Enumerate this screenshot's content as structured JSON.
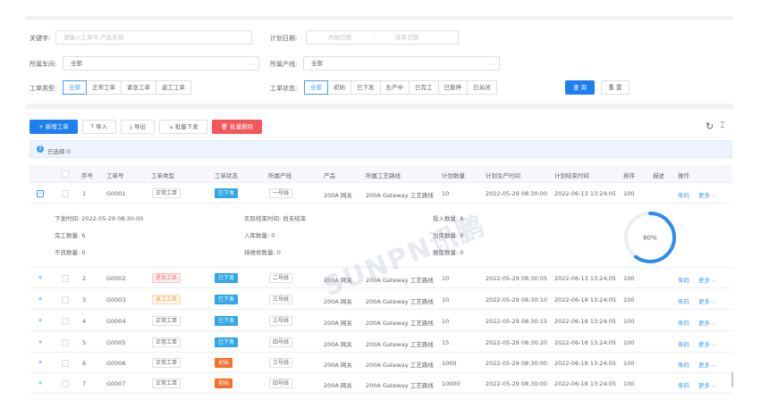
{
  "filters": {
    "keyword_label": "关键字:",
    "keyword_placeholder": "请输入工单号,产品名称",
    "date_label": "计划日期:",
    "date_start_placeholder": "开始日期",
    "date_separator": "-",
    "date_end_placeholder": "结束日期",
    "workshop_label": "所属车间:",
    "workshop_value": "全部",
    "line_label": "所属产线:",
    "line_value": "全部",
    "type_label": "工单类型:",
    "type_options": [
      "全部",
      "正常工单",
      "紧急工单",
      "返工工单"
    ],
    "type_selected": 0,
    "status_label": "工单状态:",
    "status_options": [
      "全部",
      "初始",
      "已下发",
      "生产中",
      "已完工",
      "已暂停",
      "已关闭"
    ],
    "status_selected": 0,
    "search_button": "查 询",
    "reset_button": "重 置"
  },
  "toolbar": {
    "new_button": "新增工单",
    "import_button": "导入",
    "export_button": "导出",
    "batch_issue_button": "批量下发",
    "batch_delete_button": "批量删除",
    "refresh_icon": "refresh-icon",
    "column_icon": "column-settings-icon"
  },
  "selection": {
    "text": "已选择:0"
  },
  "table": {
    "headers": [
      "序号",
      "工单号",
      "工单类型",
      "工单状态",
      "所属产线",
      "产品",
      "所属工艺路线",
      "计划数量",
      "计划生产时间",
      "计划结束时间",
      "排序",
      "描述",
      "操作"
    ],
    "rows": [
      {
        "index": "1",
        "no": "G0001",
        "type": "正常工单",
        "type_color": "default",
        "status": "已下发",
        "status_color": "blue",
        "line": "一号线",
        "product": "200A 网关",
        "route": "200A Gateway 工艺路线",
        "qty": "10",
        "start": "2022-05-29 08:30:00",
        "end": "2022-06-13 13:24:05",
        "sort": "100",
        "expanded": true
      },
      {
        "index": "2",
        "no": "G0002",
        "type": "紧急工单",
        "type_color": "red",
        "status": "已下发",
        "status_color": "blue",
        "line": "二号线",
        "product": "200A 网关",
        "route": "200A Gateway 工艺路线",
        "qty": "10",
        "start": "2022-05-29 08:30:05",
        "end": "2022-06-13 13:24:05",
        "sort": "100",
        "expanded": false
      },
      {
        "index": "3",
        "no": "G0003",
        "type": "返工工单",
        "type_color": "orange",
        "status": "已下发",
        "status_color": "blue",
        "line": "三号线",
        "product": "200A 网关",
        "route": "200A Gateway 工艺路线",
        "qty": "10",
        "start": "2022-05-29 08:30:10",
        "end": "2022-06-18 13:24:05",
        "sort": "100",
        "expanded": false
      },
      {
        "index": "4",
        "no": "G0004",
        "type": "正常工单",
        "type_color": "default",
        "status": "已下发",
        "status_color": "blue",
        "line": "三号线",
        "product": "200A 网关",
        "route": "200A Gateway 工艺路线",
        "qty": "10",
        "start": "2022-05-29 08:30:15",
        "end": "2022-06-18 13:24:05",
        "sort": "100",
        "expanded": false
      },
      {
        "index": "5",
        "no": "G0005",
        "type": "正常工单",
        "type_color": "default",
        "status": "已下发",
        "status_color": "blue",
        "line": "四号线",
        "product": "200A 网关",
        "route": "200A Gateway 工艺路线",
        "qty": "15",
        "start": "2022-05-29 08:30:20",
        "end": "2022-06-18 13:24:05",
        "sort": "100",
        "expanded": false
      },
      {
        "index": "6",
        "no": "G0006",
        "type": "正常工单",
        "type_color": "default",
        "status": "初始",
        "status_color": "orange",
        "line": "三号线",
        "product": "200A 网关",
        "route": "200A Gateway 工艺路线",
        "qty": "1000",
        "start": "2022-05-29 08:30:00",
        "end": "2022-06-18 13:24:05",
        "sort": "100",
        "expanded": false
      },
      {
        "index": "7",
        "no": "G0007",
        "type": "正常工单",
        "type_color": "default",
        "status": "初始",
        "status_color": "orange",
        "line": "四号线",
        "product": "200A 网关",
        "route": "200A Gateway 工艺路线",
        "qty": "10000",
        "start": "2022-05-29 08:30:00",
        "end": "2022-06-18 13:24:05",
        "sort": "100",
        "expanded": false
      }
    ],
    "action_barcode": "条码",
    "action_more": "更多",
    "expand_collapsed": "+",
    "expand_open": "−"
  },
  "detail": {
    "issue_time": "下发时间: 2022-05-29 08:30:00",
    "actual_end": "实际结束时间: 尚未结束",
    "input_qty": "投入数量: 6",
    "completed_qty": "完工数量: 6",
    "stock_in_qty": "入库数量: 0",
    "stock_out_qty": "出库数量: 0",
    "defect_qty": "不良数量: 0",
    "pending_repair_qty": "待维修数量: 0",
    "scrap_qty": "报废数量: 0",
    "progress_label": "60%",
    "progress_value": 0.6
  },
  "watermark": "SUNPN讯鹏",
  "colors": {
    "primary": "#1e7ff0",
    "danger": "#f5565a",
    "status_blue": "#2fa7e8",
    "status_orange": "#f5702a",
    "progress": "#2d8cf0"
  }
}
